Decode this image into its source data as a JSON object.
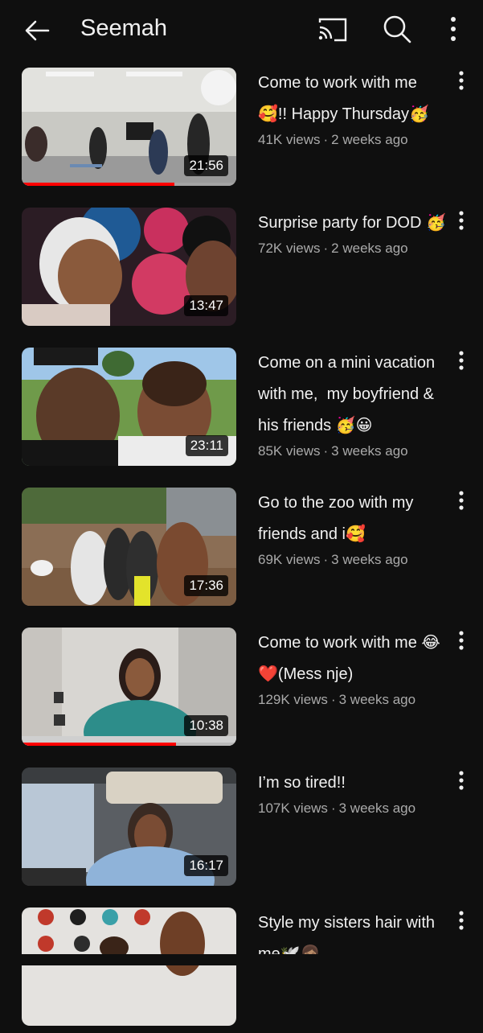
{
  "header": {
    "title": "Seemah"
  },
  "videos": [
    {
      "title": "Come to work with me 🥰!! Happy Thursday🥳",
      "views": "41K views",
      "age": "2 weeks ago",
      "duration": "21:56",
      "watched_fraction": 0.71
    },
    {
      "title": "Surprise party for DOD 🥳",
      "views": "72K views",
      "age": "2 weeks ago",
      "duration": "13:47",
      "watched_fraction": 0
    },
    {
      "title": "Come on a mini vacation with me,  my boyfriend & his friends 🥳😀",
      "views": "85K views",
      "age": "3 weeks ago",
      "duration": "23:11",
      "watched_fraction": 0
    },
    {
      "title": "Go to the zoo with my friends and i🥰",
      "views": "69K views",
      "age": "3 weeks ago",
      "duration": "17:36",
      "watched_fraction": 0
    },
    {
      "title": "Come to work with me 😂❤️(Mess nje)",
      "views": "129K views",
      "age": "3 weeks ago",
      "duration": "10:38",
      "watched_fraction": 0.72
    },
    {
      "title": "I’m so tired!!",
      "views": "107K views",
      "age": "3 weeks ago",
      "duration": "16:17",
      "watched_fraction": 0
    },
    {
      "title": "Style my sisters hair with me🕊️👩🏽",
      "views": "",
      "age": "",
      "duration": "",
      "watched_fraction": 0
    }
  ],
  "icons": {
    "back": "back-arrow-icon",
    "cast": "cast-icon",
    "search": "search-icon",
    "more": "more-vertical-icon"
  },
  "colors": {
    "background": "#0f0f0f",
    "text_primary": "#f1f1f1",
    "text_secondary": "#aaaaaa",
    "progress": "#ff0000"
  }
}
